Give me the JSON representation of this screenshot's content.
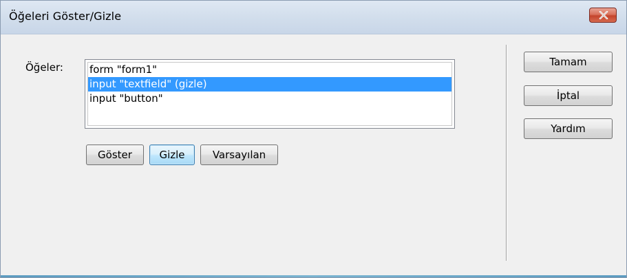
{
  "window": {
    "title": "Öğeleri Göster/Gizle",
    "close_icon": "close-x-icon"
  },
  "items_label": "Öğeler:",
  "items": [
    {
      "label": "form \"form1\"",
      "selected": false
    },
    {
      "label": "input \"textfield\" (gizle)",
      "selected": true
    },
    {
      "label": "input \"button\"",
      "selected": false
    }
  ],
  "actions": {
    "show": "Göster",
    "hide": "Gizle",
    "default": "Varsayılan"
  },
  "dialog_buttons": {
    "ok": "Tamam",
    "cancel": "İptal",
    "help": "Yardım"
  },
  "colors": {
    "selection": "#3399ff",
    "close_button": "#c4442c",
    "focus_border": "#3c7fb1"
  }
}
